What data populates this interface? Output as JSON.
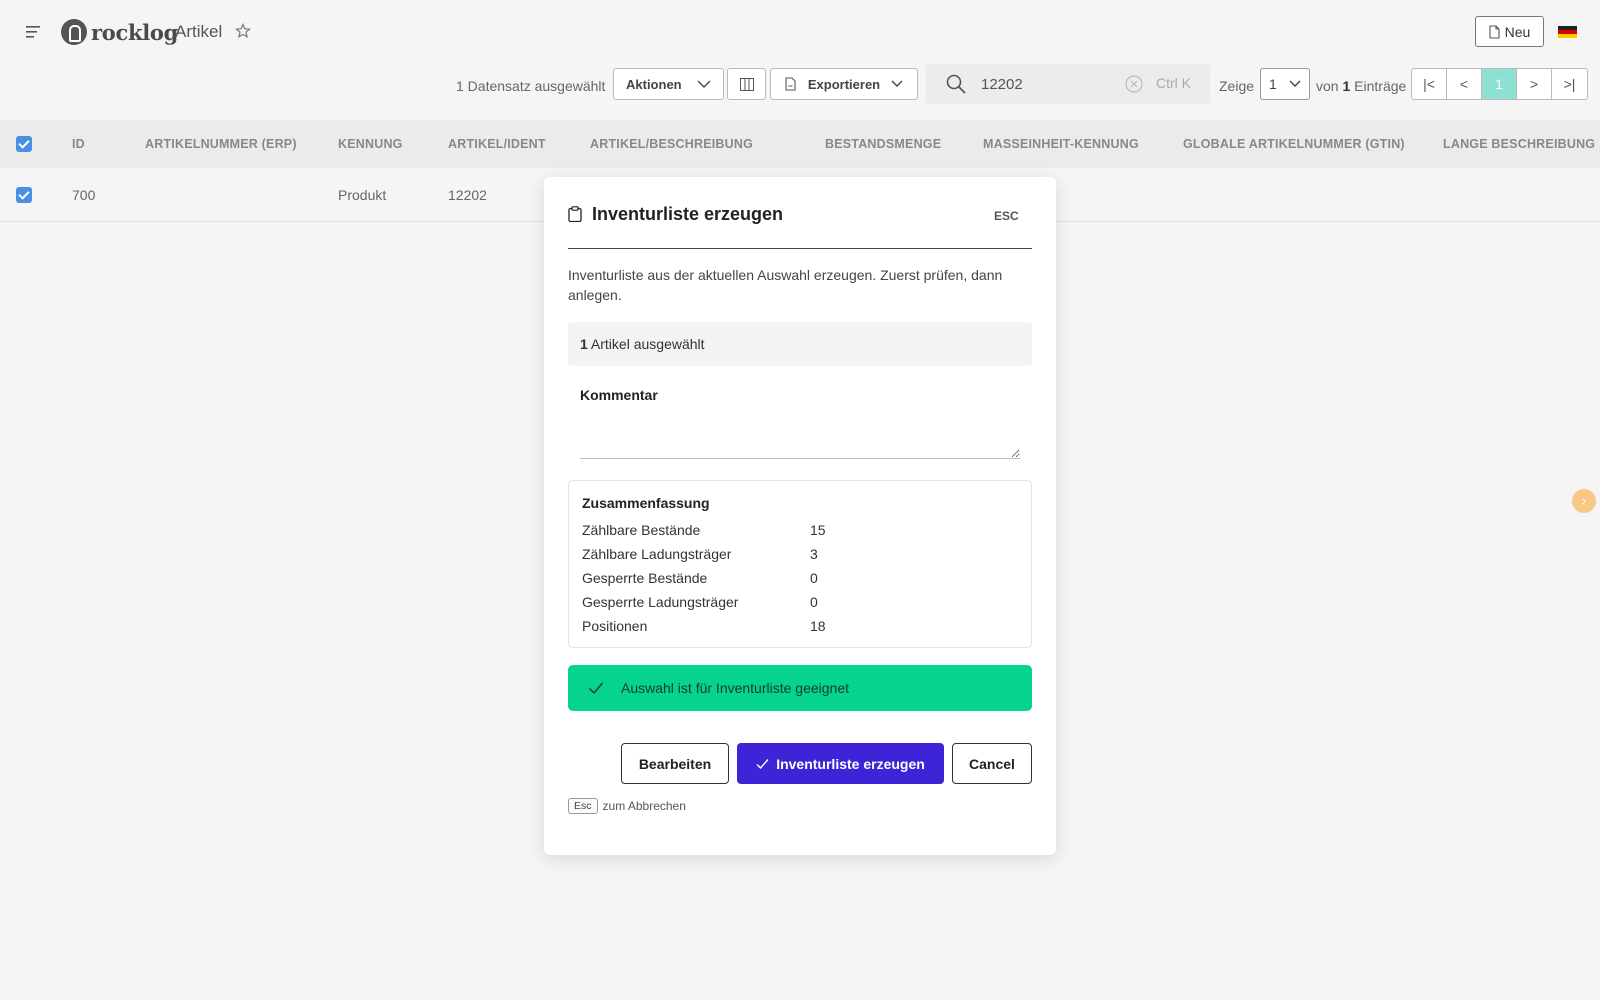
{
  "header": {
    "logo_text": "rocklog",
    "page_title": "Artikel",
    "new_button_label": "Neu"
  },
  "toolbar": {
    "selection_count": "1 Datensatz ausgewählt",
    "actions_label": "Aktionen",
    "export_label": "Exportieren",
    "search_value": "12202",
    "search_shortcut": "Ctrl K",
    "show_label": "Zeige",
    "page_size": "1",
    "entries_prefix": "von",
    "entries_count": "1",
    "entries_suffix": "Einträge",
    "pager": [
      "|<",
      "<",
      "1",
      ">",
      ">|"
    ],
    "active_page": "1"
  },
  "table": {
    "columns": [
      "ID",
      "ARTIKELNUMMER (ERP)",
      "KENNUNG",
      "ARTIKEL/IDENT",
      "ARTIKEL/BESCHREIBUNG",
      "BESTANDSMENGE",
      "MASSEINHEIT-KENNUNG",
      "GLOBALE ARTIKELNUMMER (GTIN)",
      "LANGE BESCHREIBUNG"
    ],
    "rows": [
      {
        "id": "700",
        "erp": "",
        "kennung": "Produkt",
        "ident": "12202"
      }
    ]
  },
  "modal": {
    "title": "Inventurliste erzeugen",
    "esc_label": "ESC",
    "description": "Inventurliste aus der aktuellen Auswahl erzeugen. Zuerst prüfen, dann anlegen.",
    "selected_count": "1",
    "selected_text": "Artikel ausgewählt",
    "comment_label": "Kommentar",
    "comment_value": "",
    "summary_title": "Zusammenfassung",
    "summary": [
      {
        "label": "Zählbare Bestände",
        "value": "15"
      },
      {
        "label": "Zählbare Ladungsträger",
        "value": "3"
      },
      {
        "label": "Gesperrte Bestände",
        "value": "0"
      },
      {
        "label": "Gesperrte Ladungsträger",
        "value": "0"
      },
      {
        "label": "Positionen",
        "value": "18"
      }
    ],
    "success_message": "Auswahl ist für Inventurliste geeignet",
    "edit_button": "Bearbeiten",
    "create_button": "Inventurliste erzeugen",
    "cancel_button": "Cancel",
    "kbd_key": "Esc",
    "kbd_hint": "zum Abbrechen"
  },
  "colors": {
    "primary": "#3d24d6",
    "success": "#06d38c",
    "active_page": "#8de0d2",
    "checkbox": "#4a90e2"
  }
}
